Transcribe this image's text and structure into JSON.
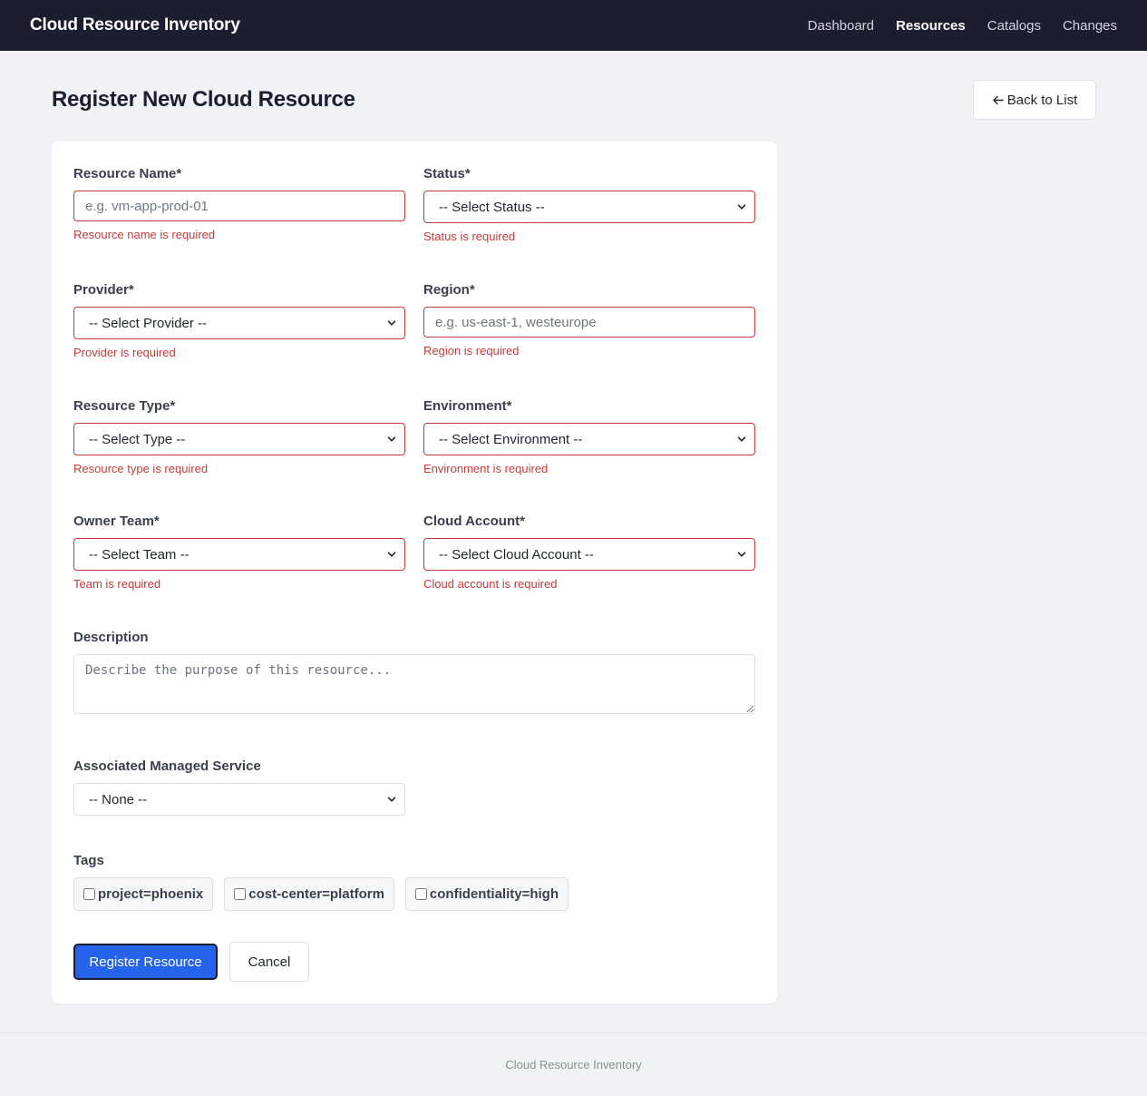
{
  "app": {
    "title": "Cloud Resource Inventory"
  },
  "nav": {
    "items": [
      {
        "label": "Dashboard",
        "active": false
      },
      {
        "label": "Resources",
        "active": true
      },
      {
        "label": "Catalogs",
        "active": false
      },
      {
        "label": "Changes",
        "active": false
      }
    ]
  },
  "page": {
    "title": "Register New Cloud Resource",
    "back_label": "Back to List",
    "back_icon": "arrow-left-icon"
  },
  "form": {
    "resource_name": {
      "label": "Resource Name*",
      "value": "",
      "placeholder": "e.g. vm-app-prod-01",
      "error": "Resource name is required"
    },
    "status": {
      "label": "Status*",
      "selected": "-- Select Status --",
      "error": "Status is required"
    },
    "provider": {
      "label": "Provider*",
      "selected": "-- Select Provider --",
      "error": "Provider is required"
    },
    "region": {
      "label": "Region*",
      "value": "",
      "placeholder": "e.g. us-east-1, westeurope",
      "error": "Region is required"
    },
    "resource_type": {
      "label": "Resource Type*",
      "selected": "-- Select Type --",
      "error": "Resource type is required"
    },
    "environment": {
      "label": "Environment*",
      "selected": "-- Select Environment --",
      "error": "Environment is required"
    },
    "owner_team": {
      "label": "Owner Team*",
      "selected": "-- Select Team --",
      "error": "Team is required"
    },
    "cloud_account": {
      "label": "Cloud Account*",
      "selected": "-- Select Cloud Account --",
      "error": "Cloud account is required"
    },
    "description": {
      "label": "Description",
      "value": "",
      "placeholder": "Describe the purpose of this resource..."
    },
    "managed_service": {
      "label": "Associated Managed Service",
      "selected": "-- None --"
    },
    "tags": {
      "label": "Tags",
      "options": [
        {
          "label": "project=phoenix",
          "checked": false
        },
        {
          "label": "cost-center=platform",
          "checked": false
        },
        {
          "label": "confidentiality=high",
          "checked": false
        }
      ]
    },
    "submit_label": "Register Resource",
    "cancel_label": "Cancel"
  },
  "footer": {
    "text": "Cloud Resource Inventory"
  },
  "colors": {
    "navbar_bg": "#1c1d2e",
    "page_bg": "#f1f2f6",
    "error": "#c53a3a",
    "primary": "#2563eb"
  }
}
